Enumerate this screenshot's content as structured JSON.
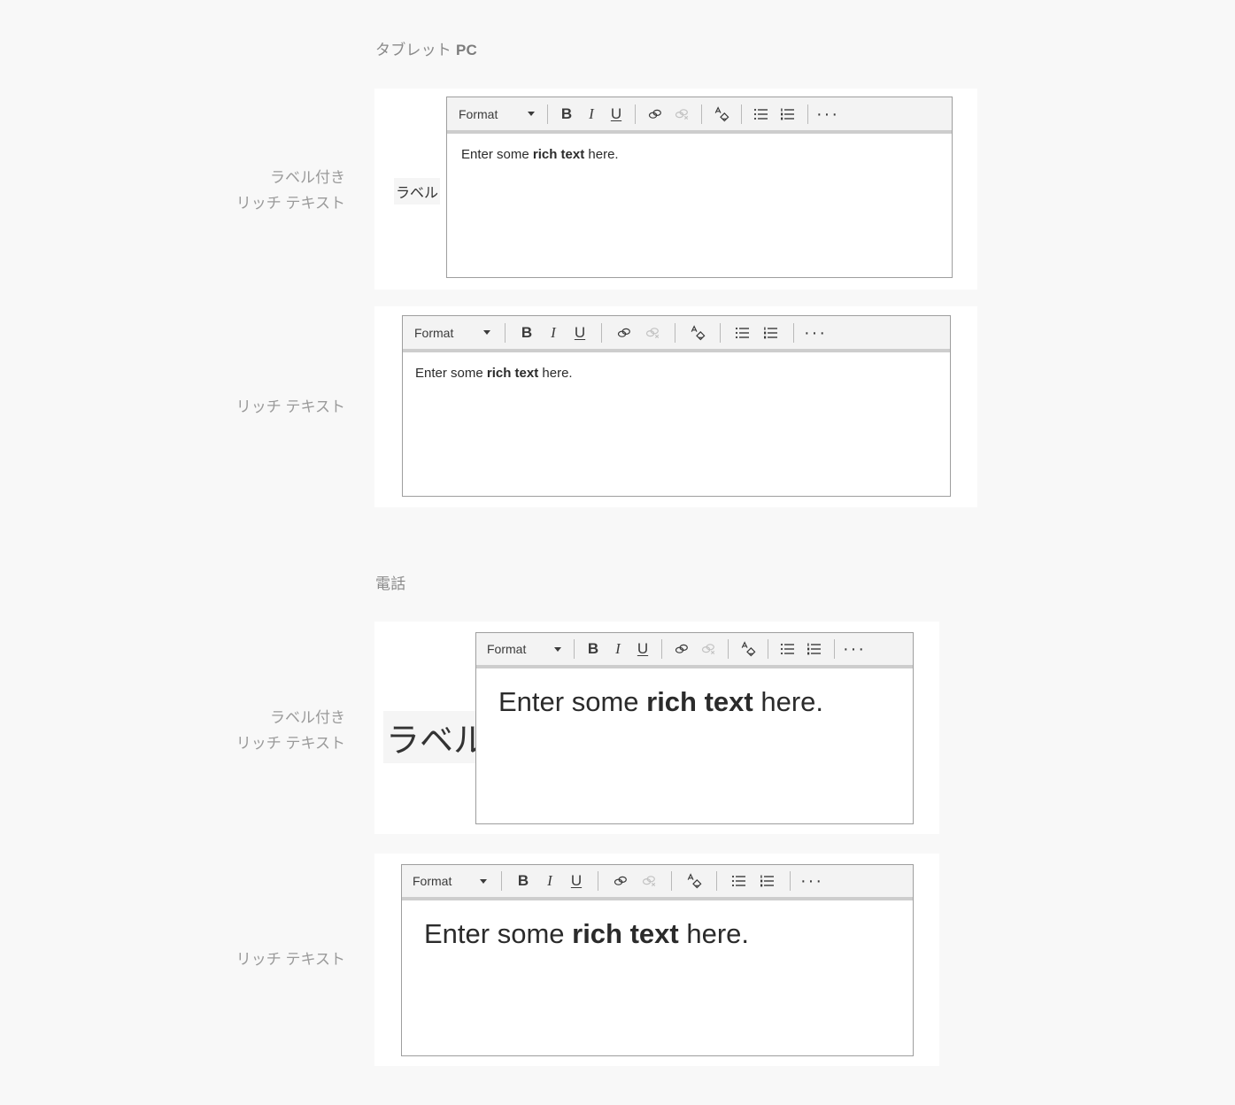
{
  "page": {
    "background_color": "#f8f8f8",
    "card_color": "#ffffff"
  },
  "sections": {
    "tablet": {
      "header_main": "タブレット ",
      "header_bold": "PC"
    },
    "phone": {
      "header": "電話"
    }
  },
  "row_labels": {
    "labeled_rich_text_line1": "ラベル付き",
    "labeled_rich_text_line2": "リッチ テキスト",
    "rich_text": "リッチ テキスト"
  },
  "field": {
    "label": "ラベル"
  },
  "toolbar": {
    "format_label": "Format",
    "caret_icon": "chevron-down-icon",
    "bold_label": "B",
    "italic_label": "I",
    "underline_label": "U",
    "link_icon": "link-icon",
    "unlink_icon": "unlink-icon",
    "clear_format_icon": "clear-formatting-icon",
    "bulleted_list_icon": "bulleted-list-icon",
    "numbered_list_icon": "numbered-list-icon",
    "overflow_label": "···"
  },
  "content": {
    "text_before": "Enter some ",
    "text_bold": "rich text",
    "text_after": " here."
  }
}
